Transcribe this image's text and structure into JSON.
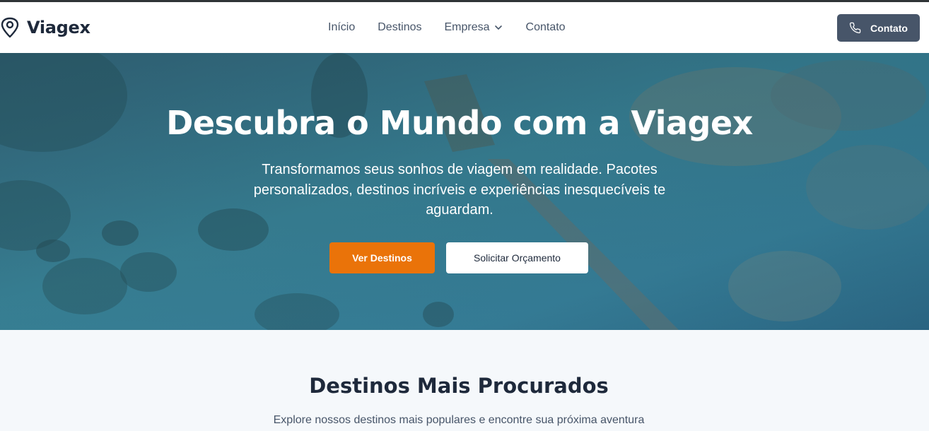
{
  "navbar": {
    "brand_icon": "map-pin-icon",
    "brand_name": "Viagex",
    "links": [
      {
        "label": "Início"
      },
      {
        "label": "Destinos"
      },
      {
        "label": "Empresa",
        "icon": "chevron-down-icon"
      },
      {
        "label": "Contato"
      }
    ],
    "contact_button": {
      "label": "Contato",
      "icon": "phone-icon"
    }
  },
  "hero": {
    "title": "Descubra o Mundo com a Viagex",
    "subtitle": "Transformamos seus sonhos de viagem em realidade. Pacotes personalizados, destinos incríveis e experiências inesquecíveis te aguardam.",
    "primary_button": "Ver Destinos",
    "secondary_button": "Solicitar Orçamento",
    "background_image": "aerial view of turquoise sea with wooden pier and coral reefs"
  },
  "section": {
    "title": "Destinos Mais Procurados",
    "subtitle": "Explore nossos destinos mais populares e encontre sua próxima aventura"
  },
  "colors": {
    "primary": "#ea7309",
    "dark_button": "#475569",
    "heading": "#1e293b",
    "nav_text": "#475569",
    "section_bg": "#f5f8fb",
    "top_border": "#2f3437"
  }
}
